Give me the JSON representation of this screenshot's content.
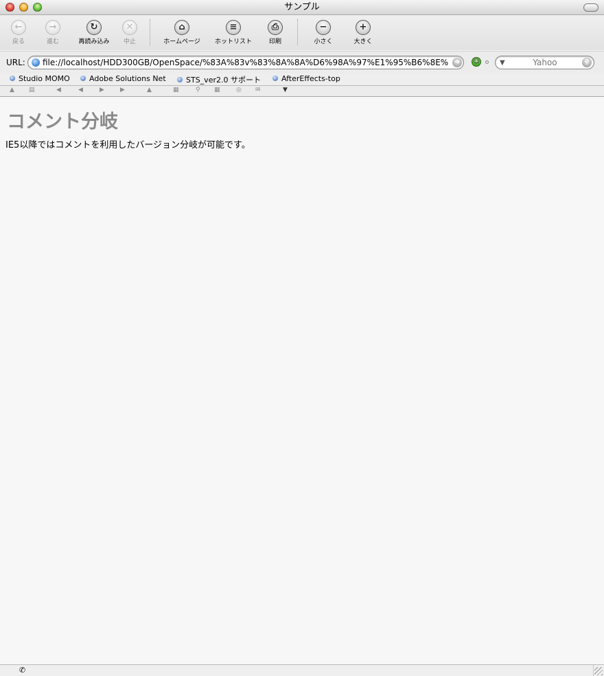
{
  "window": {
    "title": "サンプル"
  },
  "toolbar": {
    "back": "戻る",
    "forward": "進む",
    "reload": "再読み込み",
    "stop": "中止",
    "home": "ホームページ",
    "hotlist": "ホットリスト",
    "print": "印刷",
    "smaller": "小さく",
    "larger": "大きく"
  },
  "address": {
    "label": "URL:",
    "url": "file://localhost/HDD300GB/OpenSpace/%83A%83v%83%8A%8A%D6%98A%97%E1%95%B6%8E%",
    "search_placeholder": "Yahoo"
  },
  "favorites": [
    "Studio MOMO",
    "Adobe Solutions Net",
    "STS_ver2.0 サポート",
    "AfterEffects-top"
  ],
  "page": {
    "heading": "コメント分岐",
    "body": "IE5以降ではコメントを利用したバージョン分岐が可能です。"
  },
  "icons": {
    "back": "back-arrow-icon",
    "forward": "forward-arrow-icon",
    "reload": "reload-icon",
    "stop": "stop-x-icon",
    "home": "home-icon",
    "hotlist": "list-icon",
    "print": "printer-icon",
    "smaller": "minus-icon",
    "larger": "plus-icon",
    "connection": "smiley-icon",
    "status": "phone-icon"
  }
}
